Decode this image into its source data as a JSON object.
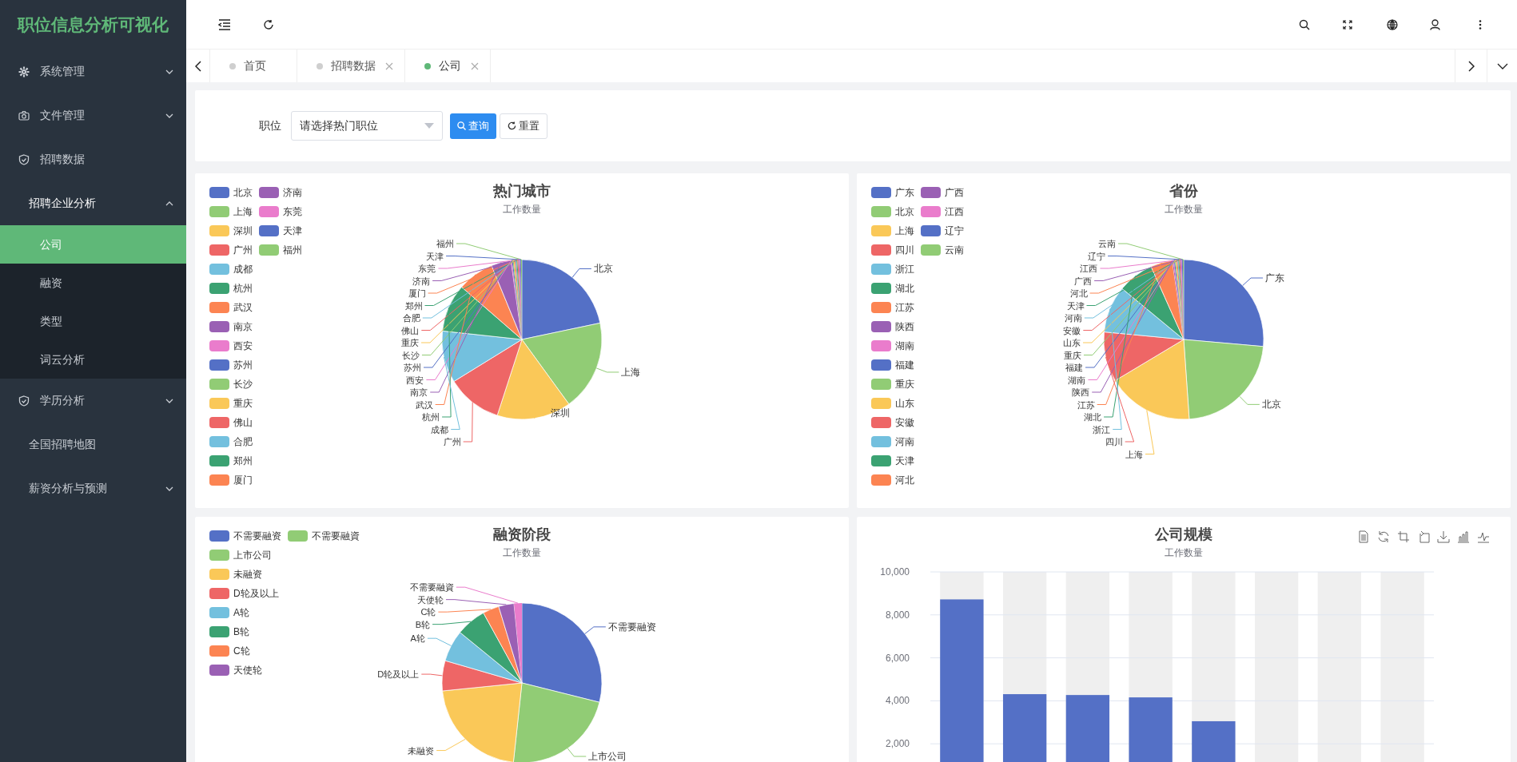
{
  "sidebar": {
    "logo": "职位信息分析可视化",
    "items": [
      {
        "kind": "folder",
        "label": "系统管理",
        "expanded": false
      },
      {
        "kind": "folder",
        "label": "文件管理",
        "expanded": false
      },
      {
        "kind": "link",
        "label": "招聘数据"
      },
      {
        "kind": "folder",
        "label": "招聘企业分析",
        "expanded": true,
        "children": [
          {
            "label": "公司",
            "selected": true
          },
          {
            "label": "融资",
            "selected": false
          },
          {
            "label": "类型",
            "selected": false
          },
          {
            "label": "词云分析",
            "selected": false
          }
        ]
      },
      {
        "kind": "folder",
        "label": "学历分析",
        "expanded": false
      },
      {
        "kind": "link",
        "label": "全国招聘地图"
      },
      {
        "kind": "folder",
        "label": "薪资分析与预测",
        "expanded": false
      }
    ]
  },
  "tabs": [
    {
      "label": "首页",
      "selected": false,
      "closable": false
    },
    {
      "label": "招聘数据",
      "selected": false,
      "closable": true
    },
    {
      "label": "公司",
      "selected": true,
      "closable": true
    }
  ],
  "filter": {
    "label": "职位",
    "placeholder": "请选择热门职位",
    "buttons": [
      "查询",
      "重置"
    ]
  },
  "pies": [
    {
      "title": "热门城市",
      "subtitle": "工作数量",
      "legend_columns": [
        [
          {
            "label": "北京",
            "color": "#5470c6"
          },
          {
            "label": "上海",
            "color": "#91cc75"
          },
          {
            "label": "深圳",
            "color": "#fac858"
          },
          {
            "label": "广州",
            "color": "#ee6666"
          },
          {
            "label": "成都",
            "color": "#73c0de"
          },
          {
            "label": "杭州",
            "color": "#3ba272"
          },
          {
            "label": "武汉",
            "color": "#fc8452"
          },
          {
            "label": "南京",
            "color": "#9a60b4"
          },
          {
            "label": "西安",
            "color": "#ea7ccc"
          },
          {
            "label": "苏州",
            "color": "#5470c6"
          },
          {
            "label": "长沙",
            "color": "#91cc75"
          },
          {
            "label": "重庆",
            "color": "#fac858"
          },
          {
            "label": "佛山",
            "color": "#ee6666"
          },
          {
            "label": "合肥",
            "color": "#73c0de"
          },
          {
            "label": "郑州",
            "color": "#3ba272"
          },
          {
            "label": "厦门",
            "color": "#fc8452"
          }
        ],
        [
          {
            "label": "济南",
            "color": "#9a60b4"
          },
          {
            "label": "东莞",
            "color": "#ea7ccc"
          },
          {
            "label": "天津",
            "color": "#5470c6"
          },
          {
            "label": "福州",
            "color": "#91cc75"
          }
        ]
      ],
      "labels_left": [
        "福州",
        "天津",
        "东莞",
        "济南",
        "厦门",
        "郑州",
        "合肥",
        "佛山",
        "重庆",
        "长沙",
        "苏州",
        "西安",
        "南京",
        "武汉",
        "杭州",
        "成都",
        "广州"
      ],
      "labels_right": [
        "北京",
        "上海",
        "深圳"
      ]
    },
    {
      "title": "省份",
      "subtitle": "工作数量",
      "legend_columns": [
        [
          {
            "label": "广东",
            "color": "#5470c6"
          },
          {
            "label": "北京",
            "color": "#91cc75"
          },
          {
            "label": "上海",
            "color": "#fac858"
          },
          {
            "label": "四川",
            "color": "#ee6666"
          },
          {
            "label": "浙江",
            "color": "#73c0de"
          },
          {
            "label": "湖北",
            "color": "#3ba272"
          },
          {
            "label": "江苏",
            "color": "#fc8452"
          },
          {
            "label": "陕西",
            "color": "#9a60b4"
          },
          {
            "label": "湖南",
            "color": "#ea7ccc"
          },
          {
            "label": "福建",
            "color": "#5470c6"
          },
          {
            "label": "重庆",
            "color": "#91cc75"
          },
          {
            "label": "山东",
            "color": "#fac858"
          },
          {
            "label": "安徽",
            "color": "#ee6666"
          },
          {
            "label": "河南",
            "color": "#73c0de"
          },
          {
            "label": "天津",
            "color": "#3ba272"
          },
          {
            "label": "河北",
            "color": "#fc8452"
          }
        ],
        [
          {
            "label": "广西",
            "color": "#9a60b4"
          },
          {
            "label": "江西",
            "color": "#ea7ccc"
          },
          {
            "label": "辽宁",
            "color": "#5470c6"
          },
          {
            "label": "云南",
            "color": "#91cc75"
          }
        ]
      ],
      "labels_left": [
        "云南",
        "辽宁",
        "江西",
        "广西",
        "河北",
        "天津",
        "河南",
        "安徽",
        "山东",
        "重庆",
        "福建",
        "湖南",
        "陕西",
        "江苏",
        "湖北",
        "浙江",
        "四川",
        "上海"
      ],
      "labels_right": [
        "广东",
        "北京"
      ]
    },
    {
      "title": "融资阶段",
      "subtitle": "工作数量",
      "legend_columns": [
        [
          {
            "label": "不需要融资",
            "color": "#5470c6"
          },
          {
            "label": "上市公司",
            "color": "#91cc75"
          },
          {
            "label": "未融资",
            "color": "#fac858"
          },
          {
            "label": "D轮及以上",
            "color": "#ee6666"
          },
          {
            "label": "A轮",
            "color": "#73c0de"
          },
          {
            "label": "B轮",
            "color": "#3ba272"
          },
          {
            "label": "C轮",
            "color": "#fc8452"
          },
          {
            "label": "天使轮",
            "color": "#9a60b4"
          }
        ],
        [
          {
            "label": "不需要融資",
            "color": "#91cc75"
          }
        ]
      ],
      "labels_left": [
        "不需要融資",
        "天使轮",
        "C轮",
        "B轮",
        "A轮",
        "D轮及以上",
        "未融资"
      ],
      "labels_right": [
        "不需要融资",
        "上市公司"
      ]
    }
  ],
  "bar_chart": {
    "title": "公司规模",
    "subtitle": "工作数量",
    "chart_data": {
      "type": "bar",
      "grid": true,
      "values": [
        8720,
        4310,
        4270,
        4160,
        3050,
        null,
        null,
        null
      ],
      "ylim": [
        0,
        10000
      ],
      "yticks": [
        {
          "value": 2000,
          "label": "2,000"
        },
        {
          "value": 4000,
          "label": "4,000"
        },
        {
          "value": 6000,
          "label": "6,000"
        },
        {
          "value": 8000,
          "label": "8,000"
        },
        {
          "value": 10000,
          "label": "10,000"
        }
      ]
    }
  }
}
